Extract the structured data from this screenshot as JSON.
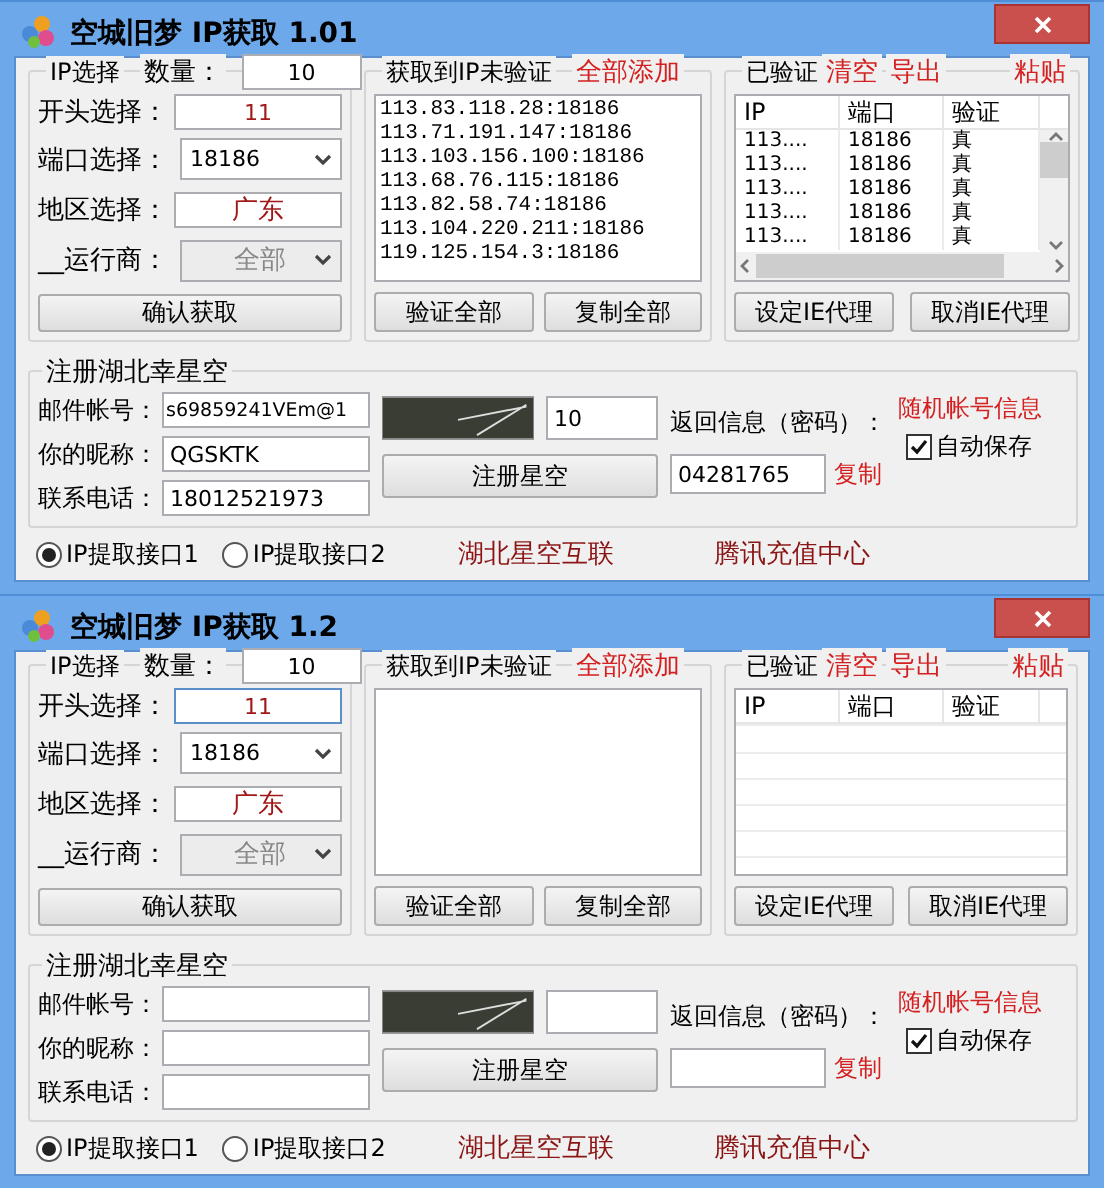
{
  "windows": [
    {
      "title": "空城旧梦 IP获取 1.01",
      "ip_select": {
        "legend": "IP选择",
        "count_label": "数量：",
        "count": "10",
        "start_label": "开头选择：",
        "start": {
          "value": "11",
          "focused": false
        },
        "port_label": "端口选择：",
        "port": "18186",
        "region_label": "地区选择：",
        "region": "广东",
        "carrier_label": "__运行商：",
        "carrier": "全部",
        "confirm": "确认获取"
      },
      "unverified": {
        "legend": "获取到IP未验证",
        "add_all": "全部添加",
        "lines": [
          "113.83.118.28:18186",
          "113.71.191.147:18186",
          "113.103.156.100:18186",
          "113.68.76.115:18186",
          "113.82.58.74:18186",
          "113.104.220.211:18186",
          "119.125.154.3:18186"
        ],
        "verify_all": "验证全部",
        "copy_all": "复制全部"
      },
      "verified": {
        "legend": "已验证",
        "clear": "清空",
        "export": "导出",
        "paste": "粘贴",
        "columns": [
          "IP",
          "端口",
          "验证"
        ],
        "rows": [
          {
            "ip": "113....",
            "port": "18186",
            "status": "真"
          },
          {
            "ip": "113....",
            "port": "18186",
            "status": "真"
          },
          {
            "ip": "113....",
            "port": "18186",
            "status": "真"
          },
          {
            "ip": "113....",
            "port": "18186",
            "status": "真"
          },
          {
            "ip": "113....",
            "port": "18186",
            "status": "真"
          }
        ],
        "set_proxy": "设定IE代理",
        "cancel_proxy": "取消IE代理"
      },
      "register": {
        "legend": "注册湖北幸星空",
        "email_label": "邮件帐号：",
        "email": "s69859241VEm@1",
        "nick_label": "你的昵称：",
        "nick": "QGSKTK",
        "phone_label": "联系电话：",
        "phone": "18012521973",
        "captcha": "10",
        "register_button": "注册星空",
        "return_label": "返回信息（密码）：",
        "return_value": "04281765",
        "copy": "复制",
        "random_info": "随机帐号信息",
        "auto_save": {
          "label": "自动保存",
          "checked": true
        }
      },
      "footer": {
        "radios": [
          {
            "label": "IP提取接口1",
            "selected": true
          },
          {
            "label": "IP提取接口2",
            "selected": false
          }
        ],
        "links": [
          "湖北星空互联",
          "腾讯充值中心"
        ]
      }
    },
    {
      "title": "空城旧梦 IP获取 1.2",
      "ip_select": {
        "legend": "IP选择",
        "count_label": "数量：",
        "count": "10",
        "start_label": "开头选择：",
        "start": {
          "value": "11",
          "focused": true
        },
        "port_label": "端口选择：",
        "port": "18186",
        "region_label": "地区选择：",
        "region": "广东",
        "carrier_label": "__运行商：",
        "carrier": "全部",
        "confirm": "确认获取"
      },
      "unverified": {
        "legend": "获取到IP未验证",
        "add_all": "全部添加",
        "verify_all": "验证全部",
        "copy_all": "复制全部"
      },
      "verified": {
        "legend": "已验证",
        "clear": "清空",
        "export": "导出",
        "paste": "粘贴",
        "columns": [
          "IP",
          "端口",
          "验证"
        ],
        "set_proxy": "设定IE代理",
        "cancel_proxy": "取消IE代理"
      },
      "register": {
        "legend": "注册湖北幸星空",
        "email_label": "邮件帐号：",
        "nick_label": "你的昵称：",
        "phone_label": "联系电话：",
        "register_button": "注册星空",
        "return_label": "返回信息（密码）：",
        "copy": "复制",
        "random_info": "随机帐号信息",
        "auto_save": {
          "label": "自动保存",
          "checked": true
        }
      },
      "footer": {
        "radios": [
          {
            "label": "IP提取接口1",
            "selected": true
          },
          {
            "label": "IP提取接口2",
            "selected": false
          }
        ],
        "links": [
          "湖北星空互联",
          "腾讯充值中心"
        ]
      }
    }
  ]
}
